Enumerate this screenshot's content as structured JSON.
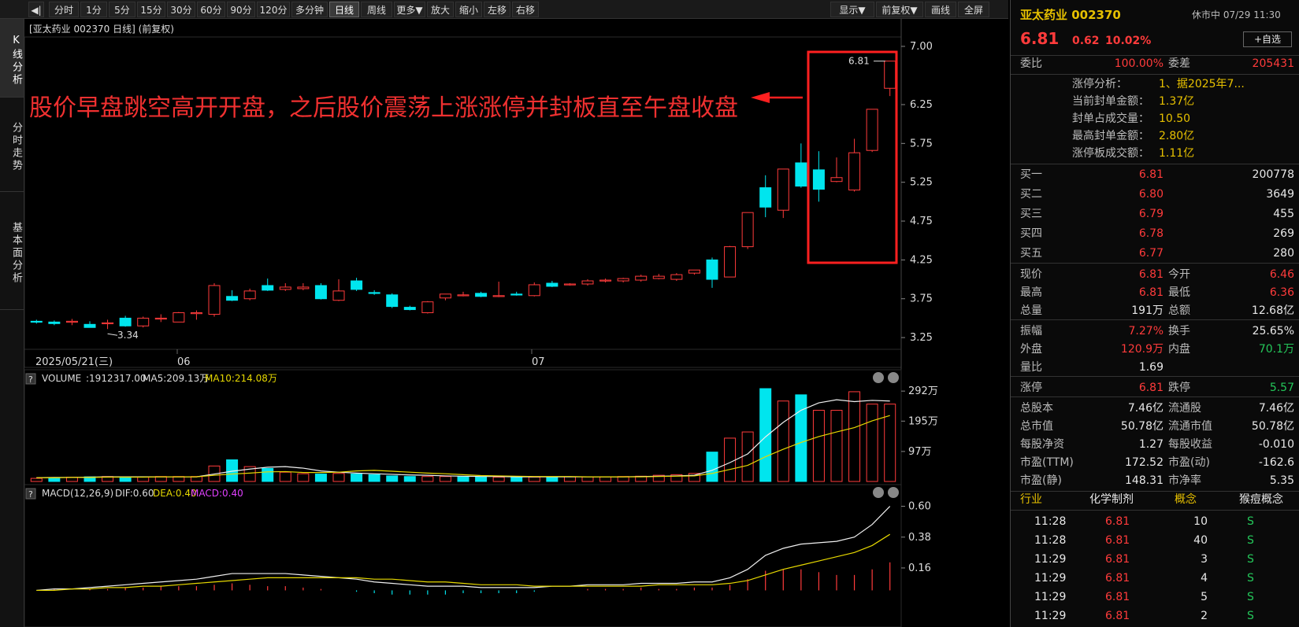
{
  "toolbar": {
    "back": "◀|",
    "periods": [
      "分时",
      "1分",
      "5分",
      "15分",
      "30分",
      "60分",
      "90分",
      "120分",
      "多分钟",
      "日线",
      "周线",
      "更多▼",
      "放大",
      "缩小",
      "左移",
      "右移"
    ],
    "active": "日线",
    "right": [
      "显示▼",
      "前复权▼",
      "画线",
      "全屏"
    ]
  },
  "left_tabs": [
    "K线分析",
    "分时走势",
    "基本面分析"
  ],
  "chart_header": "[亚太药业 002370 日线] (前复权)",
  "annotation": "股价早盘跳空高开开盘，之后股价震荡上涨涨停并封板直至午盘收盘",
  "kline": {
    "yticks": [
      "7.00",
      "6.25",
      "5.75",
      "5.25",
      "4.75",
      "4.25",
      "3.75",
      "3.25"
    ],
    "ytick_values": [
      7.0,
      6.25,
      5.75,
      5.25,
      4.75,
      4.25,
      3.75,
      3.25
    ],
    "xlabels": [
      "2025/05/21(三)",
      "06",
      "07"
    ],
    "high_label": "6.81",
    "low_label": "3.34"
  },
  "volume_panel": {
    "title_q": "?",
    "label": "VOLUME",
    "vol": ":1912317.00",
    "ma5": "MA5:209.13万",
    "ma10": "MA10:214.08万",
    "yticks": [
      "292万",
      "195万",
      "97万"
    ]
  },
  "macd_panel": {
    "title_q": "?",
    "label": "MACD(12,26,9)",
    "dif": "DIF:0.60",
    "dea": "DEA:0.40",
    "macd": "MACD:0.40",
    "yticks": [
      "0.60",
      "0.38",
      "0.16"
    ]
  },
  "chart_data": {
    "type": "candlestick",
    "ohlc": [
      [
        3.46,
        3.48,
        3.43,
        3.45
      ],
      [
        3.45,
        3.47,
        3.41,
        3.43
      ],
      [
        3.46,
        3.49,
        3.41,
        3.46
      ],
      [
        3.42,
        3.46,
        3.38,
        3.38
      ],
      [
        3.44,
        3.48,
        3.36,
        3.44
      ],
      [
        3.5,
        3.53,
        3.39,
        3.4
      ],
      [
        3.4,
        3.52,
        3.38,
        3.5
      ],
      [
        3.5,
        3.55,
        3.45,
        3.5
      ],
      [
        3.45,
        3.58,
        3.45,
        3.57
      ],
      [
        3.57,
        3.6,
        3.48,
        3.57
      ],
      [
        3.55,
        3.95,
        3.52,
        3.92
      ],
      [
        3.78,
        3.86,
        3.72,
        3.73
      ],
      [
        3.75,
        3.88,
        3.73,
        3.85
      ],
      [
        3.92,
        4.01,
        3.85,
        3.86
      ],
      [
        3.87,
        3.95,
        3.85,
        3.9
      ],
      [
        3.88,
        3.95,
        3.86,
        3.9
      ],
      [
        3.92,
        3.95,
        3.74,
        3.75
      ],
      [
        3.73,
        4.0,
        3.72,
        3.85
      ],
      [
        3.98,
        4.02,
        3.85,
        3.87
      ],
      [
        3.83,
        3.86,
        3.8,
        3.82
      ],
      [
        3.8,
        3.82,
        3.63,
        3.65
      ],
      [
        3.64,
        3.66,
        3.6,
        3.61
      ],
      [
        3.57,
        3.72,
        3.56,
        3.71
      ],
      [
        3.76,
        3.81,
        3.73,
        3.81
      ],
      [
        3.8,
        3.84,
        3.78,
        3.8
      ],
      [
        3.82,
        3.84,
        3.77,
        3.78
      ],
      [
        3.78,
        3.97,
        3.77,
        3.79
      ],
      [
        3.81,
        3.84,
        3.79,
        3.8
      ],
      [
        3.79,
        3.96,
        3.78,
        3.93
      ],
      [
        3.95,
        3.98,
        3.9,
        3.91
      ],
      [
        3.93,
        3.95,
        3.92,
        3.94
      ],
      [
        3.94,
        4.0,
        3.92,
        3.98
      ],
      [
        3.98,
        4.01,
        3.96,
        3.99
      ],
      [
        3.98,
        4.02,
        3.96,
        4.01
      ],
      [
        3.99,
        4.06,
        3.97,
        4.04
      ],
      [
        4.01,
        4.07,
        4.0,
        4.04
      ],
      [
        4.0,
        4.08,
        3.98,
        4.06
      ],
      [
        4.08,
        4.12,
        4.06,
        4.12
      ],
      [
        4.25,
        4.28,
        3.89,
        4.0
      ],
      [
        4.03,
        4.43,
        4.03,
        4.42
      ],
      [
        4.42,
        4.86,
        4.39,
        4.86
      ],
      [
        5.18,
        5.34,
        4.8,
        4.93
      ],
      [
        4.89,
        5.42,
        4.79,
        5.42
      ],
      [
        5.5,
        5.75,
        5.18,
        5.2
      ],
      [
        5.41,
        5.65,
        5.0,
        5.16
      ],
      [
        5.26,
        5.57,
        5.25,
        5.31
      ],
      [
        5.15,
        5.81,
        5.13,
        5.63
      ],
      [
        5.66,
        6.19,
        5.64,
        6.19
      ],
      [
        6.46,
        6.81,
        6.36,
        6.81
      ]
    ],
    "volume": [
      10,
      12,
      14,
      15,
      16,
      14,
      15,
      16,
      16,
      16,
      50,
      70,
      48,
      42,
      30,
      25,
      24,
      26,
      24,
      22,
      18,
      16,
      16,
      16,
      16,
      15,
      14,
      14,
      14,
      15,
      15,
      15,
      15,
      16,
      17,
      20,
      22,
      26,
      95,
      140,
      160,
      300,
      260,
      280,
      230,
      230,
      290,
      250,
      250
    ],
    "volume_up": [
      1,
      0,
      1,
      0,
      1,
      0,
      1,
      1,
      1,
      1,
      1,
      0,
      1,
      0,
      1,
      1,
      0,
      1,
      0,
      0,
      0,
      0,
      1,
      1,
      0,
      0,
      1,
      0,
      1,
      0,
      1,
      1,
      1,
      1,
      1,
      1,
      1,
      1,
      0,
      1,
      1,
      0,
      1,
      0,
      1,
      1,
      1,
      1,
      1
    ],
    "ma5": [
      12,
      13,
      13,
      14,
      15,
      15,
      15,
      15,
      15,
      15,
      24,
      33,
      40,
      46,
      48,
      43,
      34,
      30,
      27,
      25,
      23,
      21,
      20,
      18,
      17,
      16,
      16,
      15,
      15,
      15,
      15,
      15,
      15,
      15,
      16,
      17,
      18,
      20,
      36,
      61,
      89,
      144,
      191,
      230,
      254,
      264,
      258,
      262,
      260
    ],
    "ma10": [
      12,
      12,
      13,
      13,
      14,
      14,
      14,
      15,
      15,
      15,
      20,
      24,
      27,
      31,
      32,
      29,
      29,
      30,
      34,
      36,
      33,
      30,
      27,
      25,
      22,
      19,
      18,
      17,
      16,
      16,
      16,
      15,
      15,
      15,
      15,
      16,
      17,
      18,
      26,
      39,
      52,
      80,
      104,
      126,
      145,
      160,
      174,
      196,
      213
    ],
    "dif": [
      0.0,
      0.01,
      0.01,
      0.02,
      0.03,
      0.04,
      0.05,
      0.06,
      0.07,
      0.08,
      0.1,
      0.12,
      0.12,
      0.12,
      0.12,
      0.11,
      0.1,
      0.09,
      0.08,
      0.06,
      0.05,
      0.04,
      0.03,
      0.03,
      0.03,
      0.02,
      0.02,
      0.02,
      0.02,
      0.03,
      0.03,
      0.04,
      0.04,
      0.04,
      0.05,
      0.05,
      0.05,
      0.06,
      0.06,
      0.09,
      0.15,
      0.25,
      0.3,
      0.33,
      0.34,
      0.35,
      0.38,
      0.47,
      0.6
    ],
    "dea": [
      0.0,
      0.0,
      0.01,
      0.01,
      0.02,
      0.02,
      0.03,
      0.03,
      0.04,
      0.05,
      0.06,
      0.07,
      0.08,
      0.09,
      0.09,
      0.09,
      0.09,
      0.09,
      0.09,
      0.08,
      0.08,
      0.07,
      0.06,
      0.06,
      0.05,
      0.04,
      0.04,
      0.04,
      0.03,
      0.03,
      0.03,
      0.03,
      0.03,
      0.03,
      0.03,
      0.04,
      0.04,
      0.04,
      0.04,
      0.05,
      0.07,
      0.11,
      0.15,
      0.18,
      0.21,
      0.24,
      0.27,
      0.32,
      0.4
    ]
  },
  "right": {
    "title": "亚太药业 002370",
    "status": "休市中 07/29 11:30",
    "price": "6.81",
    "change": "0.62",
    "pct": "10.02%",
    "fav": "+自选",
    "weibi_label": "委比",
    "weibi": "100.00%",
    "weicha_label": "委差",
    "weicha": "205431",
    "limit_info": [
      {
        "k": "涨停分析：",
        "v": "1、据2025年7..."
      },
      {
        "k": "当前封单金额：",
        "v": "1.37亿"
      },
      {
        "k": "封单占成交量：",
        "v": "10.50"
      },
      {
        "k": "最高封单金额：",
        "v": "2.80亿"
      },
      {
        "k": "涨停板成交额：",
        "v": "1.11亿"
      }
    ],
    "bids": [
      {
        "k": "买一",
        "p": "6.81",
        "v": "200778"
      },
      {
        "k": "买二",
        "p": "6.80",
        "v": "3649"
      },
      {
        "k": "买三",
        "p": "6.79",
        "v": "455"
      },
      {
        "k": "买四",
        "p": "6.78",
        "v": "269"
      },
      {
        "k": "买五",
        "p": "6.77",
        "v": "280"
      }
    ],
    "stats1": [
      [
        "现价",
        "6.81",
        "今开",
        "6.46"
      ],
      [
        "最高",
        "6.81",
        "最低",
        "6.36"
      ],
      [
        "总量",
        "191万",
        "总额",
        "12.68亿"
      ]
    ],
    "stats2": [
      [
        "振幅",
        "7.27%",
        "换手",
        "25.65%"
      ],
      [
        "外盘",
        "120.9万",
        "内盘",
        "70.1万"
      ],
      [
        "量比",
        "1.69",
        "",
        ""
      ]
    ],
    "stats3": [
      [
        "涨停",
        "6.81",
        "跌停",
        "5.57"
      ]
    ],
    "stats4": [
      [
        "总股本",
        "7.46亿",
        "流通股",
        "7.46亿"
      ],
      [
        "总市值",
        "50.78亿",
        "流通市值",
        "50.78亿"
      ],
      [
        "每股净资",
        "1.27",
        "每股收益",
        "-0.010"
      ],
      [
        "市盈(TTM)",
        "172.52",
        "市盈(动)",
        "-162.6"
      ],
      [
        "市盈(静)",
        "148.31",
        "市净率",
        "5.35"
      ]
    ],
    "tags": [
      "行业",
      "化学制剂",
      "概念",
      "猴痘概念"
    ],
    "ticks": [
      [
        "11:28",
        "6.81",
        "10",
        "S"
      ],
      [
        "11:28",
        "6.81",
        "40",
        "S"
      ],
      [
        "11:29",
        "6.81",
        "3",
        "S"
      ],
      [
        "11:29",
        "6.81",
        "4",
        "S"
      ],
      [
        "11:29",
        "6.81",
        "5",
        "S"
      ],
      [
        "11:29",
        "6.81",
        "2",
        "S"
      ]
    ]
  }
}
